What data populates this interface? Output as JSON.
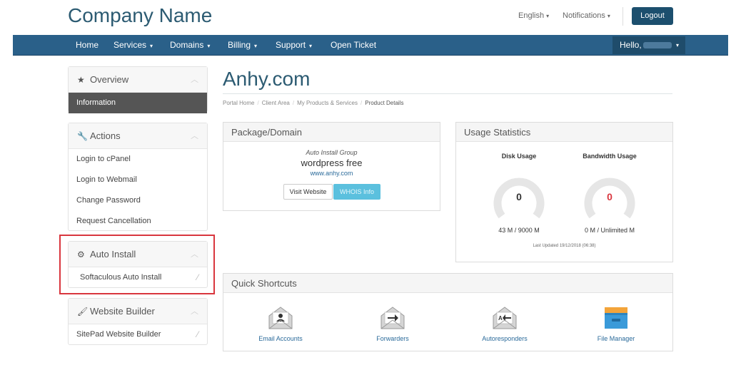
{
  "header": {
    "brand": "Company Name",
    "language": "English",
    "notifications": "Notifications",
    "logout": "Logout"
  },
  "navbar": {
    "items": [
      "Home",
      "Services",
      "Domains",
      "Billing",
      "Support",
      "Open Ticket"
    ],
    "hello": "Hello,"
  },
  "sidebar": {
    "overview": {
      "title": "Overview",
      "items": [
        "Information"
      ]
    },
    "actions": {
      "title": "Actions",
      "items": [
        "Login to cPanel",
        "Login to Webmail",
        "Change Password",
        "Request Cancellation"
      ]
    },
    "auto_install": {
      "title": "Auto Install",
      "items": [
        "Softaculous Auto Install"
      ]
    },
    "website_builder": {
      "title": "Website Builder",
      "items": [
        "SitePad Website Builder"
      ]
    }
  },
  "main": {
    "title": "Anhy.com",
    "breadcrumb": [
      "Portal Home",
      "Client Area",
      "My Products & Services",
      "Product Details"
    ]
  },
  "package": {
    "heading": "Package/Domain",
    "group": "Auto Install Group",
    "name": "wordpress free",
    "domain": "www.anhy.com",
    "visit_button": "Visit Website",
    "whois_button": "WHOIS Info"
  },
  "usage": {
    "heading": "Usage Statistics",
    "disk": {
      "title": "Disk Usage",
      "value": "0",
      "detail": "43 M / 9000 M",
      "value_color": "#333333"
    },
    "bandwidth": {
      "title": "Bandwidth Usage",
      "value": "0",
      "detail": "0 M / Unlimited M",
      "value_color": "#d9363e"
    },
    "updated": "Last Updated 19/12/2018 (06:38)"
  },
  "shortcuts": {
    "heading": "Quick Shortcuts",
    "items": [
      "Email Accounts",
      "Forwarders",
      "Autoresponders",
      "File Manager"
    ]
  },
  "colors": {
    "brand": "#2c5b72",
    "navbar": "#2a6089",
    "highlight": "#d9363e",
    "whois": "#5bc0de"
  }
}
